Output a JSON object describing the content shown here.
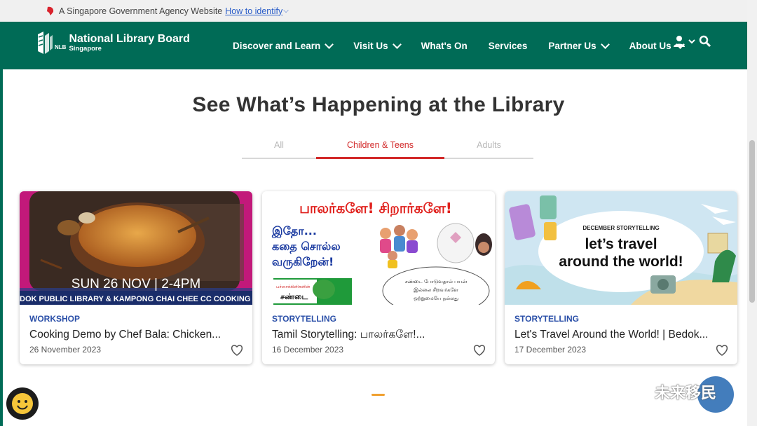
{
  "gov_banner": {
    "text": "A Singapore Government Agency Website",
    "link": "How to identify"
  },
  "brand": {
    "name": "National Library Board",
    "sub": "Singapore",
    "abbr": "NLB"
  },
  "nav": {
    "items": [
      {
        "label": "Discover and Learn",
        "dropdown": true
      },
      {
        "label": "Visit Us",
        "dropdown": true
      },
      {
        "label": "What's On",
        "dropdown": false
      },
      {
        "label": "Services",
        "dropdown": false
      },
      {
        "label": "Partner Us",
        "dropdown": true
      },
      {
        "label": "About Us",
        "dropdown": true
      }
    ]
  },
  "section": {
    "heading": "See What’s Happening at the Library"
  },
  "tabs": [
    {
      "label": "All",
      "active": false
    },
    {
      "label": "Children & Teens",
      "active": true
    },
    {
      "label": "Adults",
      "active": false
    }
  ],
  "cards": [
    {
      "category": "WORKSHOP",
      "title": "Cooking Demo by Chef Bala: Chicken...",
      "date": "26 November 2023",
      "image": {
        "date_text": "SUN 26 NOV | 2-4PM",
        "banner": "DOK PUBLIC LIBRARY & KAMPONG CHAI CHEE CC COOKING STUD"
      }
    },
    {
      "category": "STORYTELLING",
      "title": "Tamil Storytelling: பாலர்களே!...",
      "date": "16 December 2023",
      "image": {
        "headline": "பாலர்களே! சிறார்களே!",
        "line1": "இதோ...",
        "line2": "கதை சொல்ல",
        "line3": "வருகிறேன்!",
        "box_label": "பச்சைக்கிளிகளின்",
        "box_word": "சண்டை",
        "oval1": "சண்டை போடுவதால் பயன்",
        "oval2": "இல்லை சிறவர்களே",
        "oval3": "ஒற்றுமையே நல்லது"
      }
    },
    {
      "category": "STORYTELLING",
      "title": "Let's Travel Around the World! | Bedok...",
      "date": "17 December 2023",
      "image": {
        "tag": "DECEMBER STORYTELLING",
        "line1": "let’s travel",
        "line2": "around the world!"
      }
    }
  ],
  "watermark": "未来移民",
  "colors": {
    "nav_bg": "#006b56",
    "accent_red": "#d22a2a",
    "category_blue": "#2a4fa8",
    "pager_orange": "#f0a030"
  }
}
